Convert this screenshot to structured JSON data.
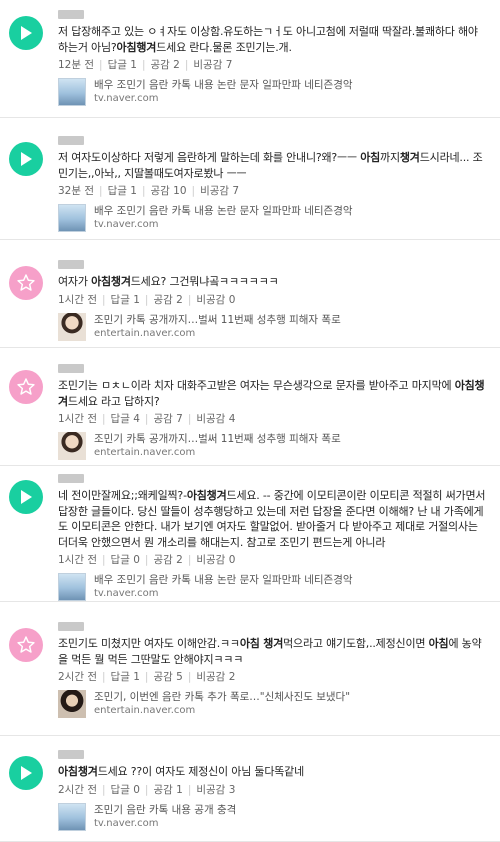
{
  "comments": [
    {
      "avatar": "green",
      "icon": "play-icon",
      "body": [
        {
          "t": "저 답장해주고 있는 ㅇㅕ자도 이상함.유도하는ㄱㅓ도 아니고첨에 저럴때 딱잘라.불쾌하다 해야 하는거 아님?"
        },
        {
          "t": "아침행겨",
          "b": true
        },
        {
          "t": "드세요 란다.물론 조민기는.개."
        }
      ],
      "time": "12분 전",
      "reply_label": "답글",
      "replies": "1",
      "like_label": "공감",
      "likes": "2",
      "dislike_label": "비공감",
      "dislikes": "7",
      "link_title": "배우 조민기 음란 카톡 내용 논란 문자 일파만파 네티즌경악",
      "link_domain": "tv.naver.com",
      "thumb": "tv"
    },
    {
      "avatar": "green",
      "icon": "play-icon",
      "body": [
        {
          "t": "저 여자도이상하다 저렇게 음란하게 말하는데 화를 안내니?왜?ㅡㅡ "
        },
        {
          "t": "아침",
          "b": true
        },
        {
          "t": "까지"
        },
        {
          "t": "챙겨",
          "b": true
        },
        {
          "t": "드시라네... 조민기는,,아놔,, 지딸볼때도여자로봤나 ㅡㅡ"
        }
      ],
      "time": "32분 전",
      "reply_label": "답글",
      "replies": "1",
      "like_label": "공감",
      "likes": "10",
      "dislike_label": "비공감",
      "dislikes": "7",
      "link_title": "배우 조민기 음란 카톡 내용 논란 문자 일파만파 네티즌경악",
      "link_domain": "tv.naver.com",
      "thumb": "tv"
    },
    {
      "avatar": "pink",
      "icon": "star-icon",
      "body": [
        {
          "t": "여자가 "
        },
        {
          "t": "아침챙겨",
          "b": true
        },
        {
          "t": "드세요? 그건뭐냐곸ㅋㅋㅋㅋㅋㅋ"
        }
      ],
      "time": "1시간 전",
      "reply_label": "답글",
      "replies": "1",
      "like_label": "공감",
      "likes": "2",
      "dislike_label": "비공감",
      "dislikes": "0",
      "link_title": "조민기 카톡 공개까지…벌써 11번째 성추행 피해자 폭로",
      "link_domain": "entertain.naver.com",
      "thumb": "photo"
    },
    {
      "avatar": "pink",
      "icon": "star-icon",
      "body": [
        {
          "t": "조민기는 ㅁㅊㄴ이라 치자 대화주고받은 여자는 무슨생각으로 문자를 받아주고 마지막에 "
        },
        {
          "t": "아침챙겨",
          "b": true
        },
        {
          "t": "드세요 라고 답하지?"
        }
      ],
      "time": "1시간 전",
      "reply_label": "답글",
      "replies": "4",
      "like_label": "공감",
      "likes": "7",
      "dislike_label": "비공감",
      "dislikes": "4",
      "link_title": "조민기 카톡 공개까지…벌써 11번째 성추행 피해자 폭로",
      "link_domain": "entertain.naver.com",
      "thumb": "photo"
    },
    {
      "avatar": "green",
      "icon": "play-icon",
      "body": [
        {
          "t": "네 전이만잘께요;;왜케일찍?-"
        },
        {
          "t": "아침챙겨",
          "b": true
        },
        {
          "t": "드세요. -- 중간에 이모티콘이란 이모티콘 적절히 써가면서 답장한 글들이다. 당신 딸들이 성추행당하고 있는데 저런 답장을 준다면 이해해? 난 내 가족에게도 이모티콘은 안한다. 내가 보기엔 여자도 할말없어. 받아줄거 다 받아주고 제대로 거절의사는 더더욱 안했으면서 뭔 개소리를 해대는지. 참고로 조민기 편드는게 아니라"
        }
      ],
      "time": "1시간 전",
      "reply_label": "답글",
      "replies": "0",
      "like_label": "공감",
      "likes": "2",
      "dislike_label": "비공감",
      "dislikes": "0",
      "link_title": "배우 조민기 음란 카톡 내용 논란 문자 일파만파 네티즌경악",
      "link_domain": "tv.naver.com",
      "thumb": "tv"
    },
    {
      "avatar": "pink",
      "icon": "star-icon",
      "body": [
        {
          "t": "조민기도 미쳤지만 여자도 이해안감.ㅋㅋ"
        },
        {
          "t": "아침 챙겨",
          "b": true
        },
        {
          "t": "먹으라고 얘기도함,..제정신이면 "
        },
        {
          "t": "아침",
          "b": true
        },
        {
          "t": "에 농약을 먹든 뭘 먹든 그딴말도 안해야지ㅋㅋㅋ"
        }
      ],
      "time": "2시간 전",
      "reply_label": "답글",
      "replies": "1",
      "like_label": "공감",
      "likes": "5",
      "dislike_label": "비공감",
      "dislikes": "2",
      "link_title": "조민기, 이번엔 음란 카톡 추가 폭로…\"신체사진도 보냈다\"",
      "link_domain": "entertain.naver.com",
      "thumb": "photo2"
    },
    {
      "avatar": "green",
      "icon": "play-icon",
      "body": [
        {
          "t": "아침챙겨",
          "b": true
        },
        {
          "t": "드세요 ??이 여자도 제정신이 아님 둘다똑같네"
        }
      ],
      "time": "2시간 전",
      "reply_label": "답글",
      "replies": "0",
      "like_label": "공감",
      "likes": "1",
      "dislike_label": "비공감",
      "dislikes": "3",
      "link_title": "조민기 음란 카톡 내용 공개 충격",
      "link_domain": "tv.naver.com",
      "thumb": "tv"
    }
  ]
}
